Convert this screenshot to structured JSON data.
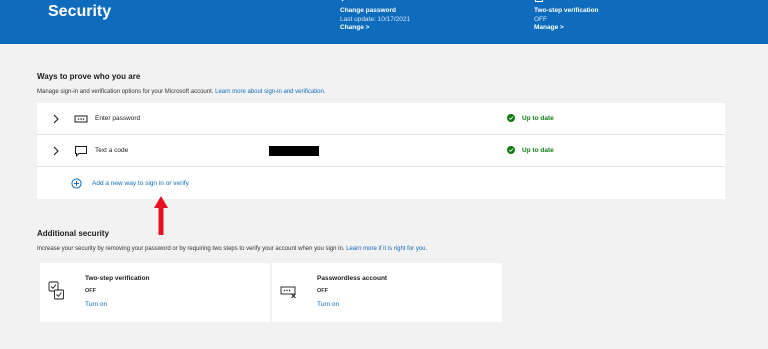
{
  "header": {
    "title": "Security",
    "change_password": {
      "title": "Change password",
      "subtitle": "Last update: 10/17/2021",
      "link": "Change >"
    },
    "two_step": {
      "title": "Two-step verification",
      "subtitle": "OFF",
      "link": "Manage >"
    }
  },
  "ways": {
    "title": "Ways to prove who you are",
    "description": "Manage sign-in and verification options for your Microsoft account.",
    "description_link": "Learn more about sign-in and verification.",
    "methods": [
      {
        "label": "Enter password",
        "status": "Up to date",
        "icon": "password-icon"
      },
      {
        "label": "Text a code",
        "status": "Up to date",
        "icon": "message-icon"
      }
    ],
    "add_label": "Add a new way to sign in or verify"
  },
  "additional": {
    "title": "Additional security",
    "description": "Increase your security by removing your password or by requiring two steps to verify your account when you sign in.",
    "description_link": "Learn more if it is right for you.",
    "tiles": [
      {
        "title": "Two-step verification",
        "state": "OFF",
        "link": "Turn on",
        "icon": "two-step-icon"
      },
      {
        "title": "Passwordless account",
        "state": "OFF",
        "link": "Turn on",
        "icon": "passwordless-icon"
      }
    ]
  },
  "colors": {
    "header_bg": "#0f6cbd",
    "link": "#0f6cbd",
    "status_ok": "#107c10",
    "annotation_arrow": "#e81123"
  }
}
